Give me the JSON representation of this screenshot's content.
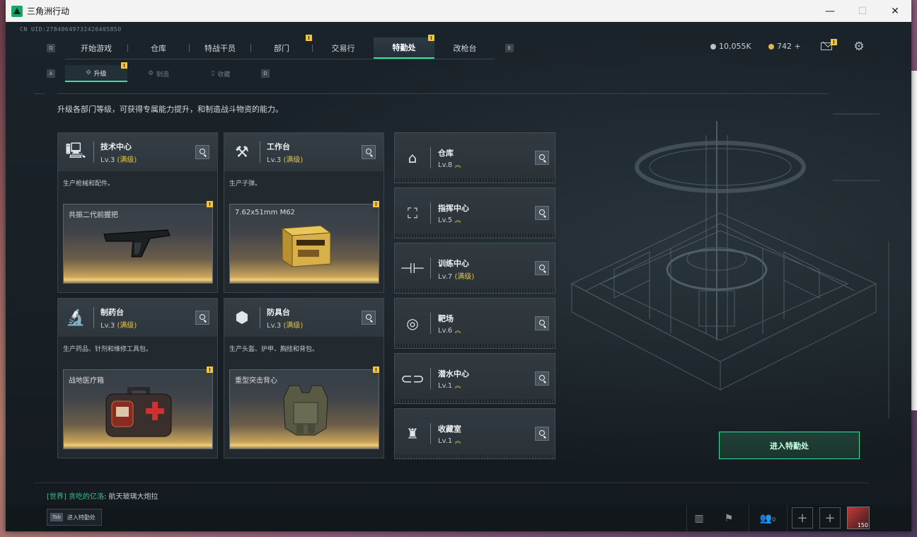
{
  "window": {
    "title": "三角洲行动",
    "minimize": "—",
    "maximize": "☐",
    "close": "✕"
  },
  "uid": "CN UID:2784064973242640585O",
  "keys": {
    "nav_left": "Q",
    "nav_right": "E",
    "sub_left": "A",
    "sub_right": "D"
  },
  "nav": {
    "tabs": [
      {
        "label": "开始游戏",
        "badge": ""
      },
      {
        "label": "仓库",
        "badge": ""
      },
      {
        "label": "特战干员",
        "badge": ""
      },
      {
        "label": "部门",
        "badge": "!"
      },
      {
        "label": "交易行",
        "badge": ""
      },
      {
        "label": "特勤处",
        "badge": "!",
        "active": true
      },
      {
        "label": "改枪台",
        "badge": ""
      }
    ]
  },
  "currency": {
    "silver": "10,055K",
    "gold": "742 +"
  },
  "mail_badge": "!",
  "subnav": {
    "tabs": [
      {
        "label": "升级",
        "badge": "!",
        "active": true
      },
      {
        "label": "制造",
        "badge": ""
      },
      {
        "label": "收藏",
        "badge": ""
      }
    ]
  },
  "description": "升级各部门等级，可获得专属能力提升，和制造战斗物资的能力。",
  "workshops": [
    {
      "name": "技术中心",
      "level": "Lv.3",
      "max": "(满级)",
      "desc": "生产枪械和配件。",
      "product": "共振二代前握把",
      "badge": "!",
      "icon": "computer-icon"
    },
    {
      "name": "工作台",
      "level": "Lv.3",
      "max": "(满级)",
      "desc": "生产子弹。",
      "product": "7.62x51mm M62",
      "badge": "!",
      "icon": "tools-icon"
    },
    {
      "name": "制药台",
      "level": "Lv.3",
      "max": "(满级)",
      "desc": "生产药品、针剂和维修工具包。",
      "product": "战地医疗箱",
      "badge": "!",
      "icon": "microscope-icon"
    },
    {
      "name": "防具台",
      "level": "Lv.3",
      "max": "(满级)",
      "desc": "生产头盔、护甲、胸挂和背包。",
      "product": "重型突击背心",
      "badge": "!",
      "icon": "cubes-icon"
    }
  ],
  "rooms": [
    {
      "name": "仓库",
      "level": "Lv.8",
      "max": "",
      "up": "︽",
      "icon": "warehouse-icon"
    },
    {
      "name": "指挥中心",
      "level": "Lv.5",
      "max": "",
      "up": "︽",
      "icon": "command-icon"
    },
    {
      "name": "训练中心",
      "level": "Lv.7",
      "max": "(满级)",
      "up": "",
      "icon": "dumbbell-icon"
    },
    {
      "name": "靶场",
      "level": "Lv.6",
      "max": "",
      "up": "︽",
      "icon": "target-icon"
    },
    {
      "name": "潜水中心",
      "level": "Lv.1",
      "max": "",
      "up": "︽",
      "icon": "goggles-icon"
    },
    {
      "name": "收藏室",
      "level": "Lv.1",
      "max": "",
      "up": "︽",
      "icon": "trophy-icon"
    }
  ],
  "enter_button": "进入特勤处",
  "chat": {
    "channel": "[世界]",
    "user": "贪吃的亿洛",
    "message": ": 航天玻璃大炮拉"
  },
  "bottom": {
    "tab_key": "Tab",
    "tab_label": "进入特勤处",
    "friends_count": "0",
    "avatar_level": "150"
  }
}
